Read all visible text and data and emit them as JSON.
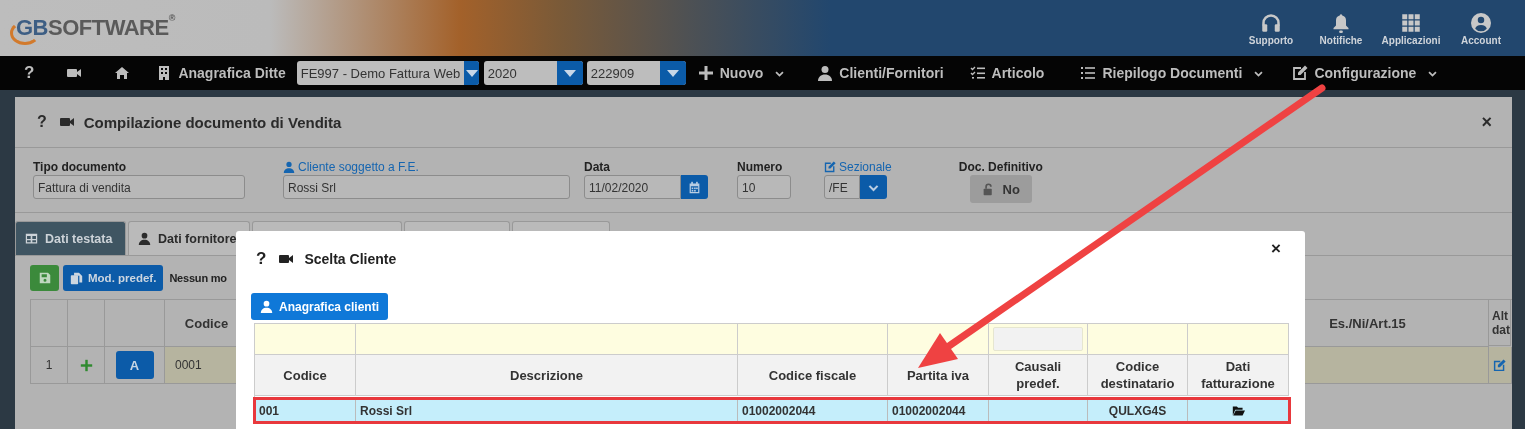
{
  "header": {
    "logo": {
      "mark": "GB",
      "word": "SOFTWARE",
      "registered": "®"
    },
    "links": [
      {
        "kind": "headset",
        "label": "Supporto"
      },
      {
        "kind": "bell",
        "label": "Notifiche"
      },
      {
        "kind": "grid",
        "label": "Applicazioni"
      },
      {
        "kind": "account",
        "label": "Account"
      }
    ]
  },
  "navbar": [
    {
      "kind": "help",
      "label": "?"
    },
    {
      "kind": "video"
    },
    {
      "kind": "home"
    },
    {
      "kind": "building",
      "label": "Anagrafica Ditte",
      "dropdown": false
    },
    {
      "kind": "select",
      "value": "FE997 - Demo Fattura Web"
    },
    {
      "kind": "select",
      "value": "2020"
    },
    {
      "kind": "select",
      "value": "222909"
    },
    {
      "kind": "plus",
      "label": "Nuovo",
      "dropdown": true
    },
    {
      "kind": "user",
      "label": "Clienti/Fornitori",
      "dropdown": false
    },
    {
      "kind": "checklist",
      "label": "Articolo",
      "dropdown": false
    },
    {
      "kind": "list",
      "label": "Riepilogo Documenti",
      "dropdown": true
    },
    {
      "kind": "edit",
      "label": "Configurazione",
      "dropdown": true
    }
  ],
  "panel": {
    "help": "?",
    "title": "Compilazione documento di Vendita",
    "close": "×",
    "fields": [
      {
        "kind": "text",
        "label": "Tipo documento",
        "value": "Fattura di vendita"
      },
      {
        "kind": "client",
        "label": "Cliente soggetto a F.E.",
        "value": "Rossi Srl"
      },
      {
        "kind": "date",
        "label": "Data",
        "value": "11/02/2020"
      },
      {
        "kind": "number",
        "label": "Numero",
        "value": "10"
      },
      {
        "kind": "select",
        "label": "Sezionale",
        "value": "/FE"
      },
      {
        "kind": "toggle",
        "label": "Doc. Definitivo",
        "value": "No",
        "on": false
      }
    ],
    "tabs": [
      {
        "label": "Dati testata",
        "selected": true
      },
      {
        "label": "Dati fornitore",
        "selected": false
      },
      {
        "selected": false
      },
      {
        "selected": false
      },
      {
        "selected": false
      }
    ],
    "toolbar": {
      "model_button": "Mod. predef.",
      "note": "Nessun mo"
    },
    "table": {
      "columns": [
        "Codice",
        "Es./Ni/Art.15",
        "Alt dat"
      ],
      "rows": [
        {
          "number": "1",
          "action": "A",
          "codice": "0001"
        }
      ]
    }
  },
  "dialog": {
    "help": "?",
    "title": "Scelta Cliente",
    "close": "×",
    "button": "Anagrafica clienti",
    "table": {
      "columns": [
        "Codice",
        "Descrizione",
        "Codice fiscale",
        "Partita iva",
        "Causali predef.",
        "Codice destinatario",
        "Dati fatturazione"
      ],
      "rows": [
        {
          "codice": "001",
          "descrizione": "Rossi Srl",
          "codice_fiscale": "01002002044",
          "partita_iva": "01002002044",
          "codice_destinatario": "QULXG4S",
          "selected": true,
          "highlighted": true
        }
      ]
    }
  },
  "annotation_arrow": true
}
